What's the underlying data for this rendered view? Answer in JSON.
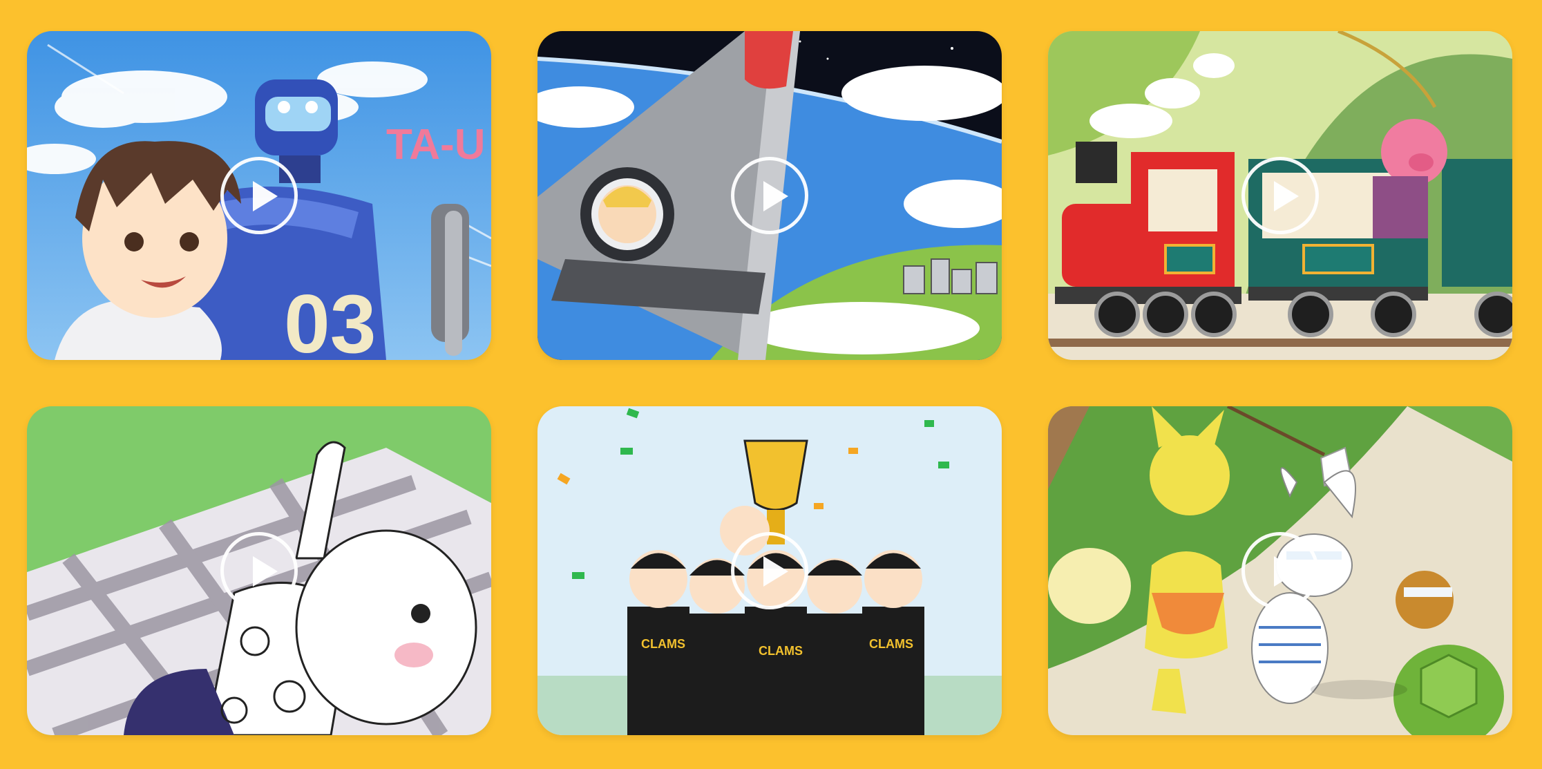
{
  "theme": {
    "background": "#FCC12D",
    "play_icon_color": "#FFFFFF"
  },
  "videos": [
    {
      "id": "v1",
      "scene_text": "TA-U",
      "badge_number": "03",
      "icon": "play-icon"
    },
    {
      "id": "v2",
      "icon": "play-icon"
    },
    {
      "id": "v3",
      "icon": "play-icon"
    },
    {
      "id": "v4",
      "icon": "play-icon"
    },
    {
      "id": "v5",
      "jersey_text": "CLAMS",
      "icon": "play-icon"
    },
    {
      "id": "v6",
      "icon": "play-icon"
    }
  ]
}
